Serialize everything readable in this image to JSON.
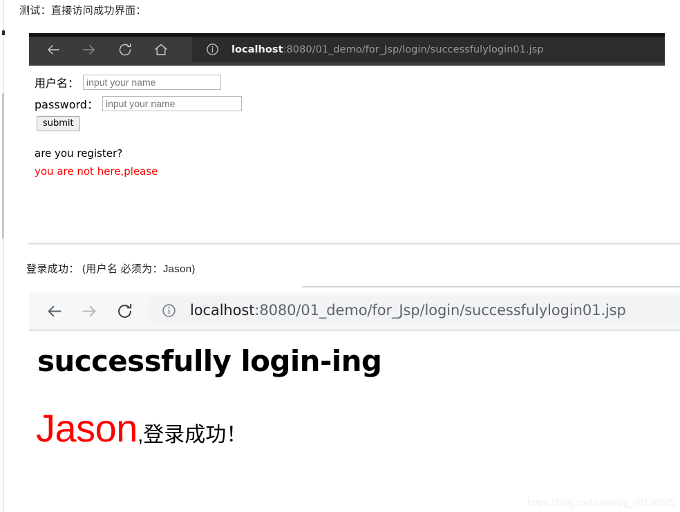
{
  "captions": {
    "top": "测试：直接访问成功界面：",
    "middle": "登录成功： (用户名 必须为：Jason)"
  },
  "browser_dark": {
    "theme_background": "#3b3b3b",
    "icons": {
      "back": "back-arrow-icon",
      "forward": "forward-arrow-icon",
      "reload": "reload-icon",
      "home": "home-icon",
      "info": "info-circle-icon"
    },
    "url": {
      "host": "localhost",
      "path": ":8080/01_demo/for_Jsp/login/successfulylogin01.jsp",
      "full": "localhost:8080/01_demo/for_Jsp/login/successfulylogin01.jsp"
    }
  },
  "login_form": {
    "username_label": "用户名：",
    "username_placeholder": "input your name",
    "username_value": "",
    "password_label": "password：",
    "password_placeholder": "input your name",
    "password_value": "",
    "submit_label": "submit",
    "register_prompt": "are you register?",
    "warning_text": "you are not here,please",
    "warning_color": "#ff0000"
  },
  "browser_light": {
    "theme_background": "#f6f7f8",
    "icons": {
      "back": "back-arrow-icon",
      "forward": "forward-arrow-icon",
      "reload": "reload-icon",
      "info": "info-circle-icon"
    },
    "url": {
      "host": "localhost",
      "path": ":8080/01_demo/for_Jsp/login/successfulylogin01.jsp",
      "full": "localhost:8080/01_demo/for_Jsp/login/successfulylogin01.jsp"
    }
  },
  "success_page": {
    "heading": "successfully login-ing",
    "username": "Jason",
    "username_color": "#ff0000",
    "message_suffix": ",登录成功！"
  },
  "watermark": {
    "text": "https://blog.csdn.net/qq_48146525"
  }
}
